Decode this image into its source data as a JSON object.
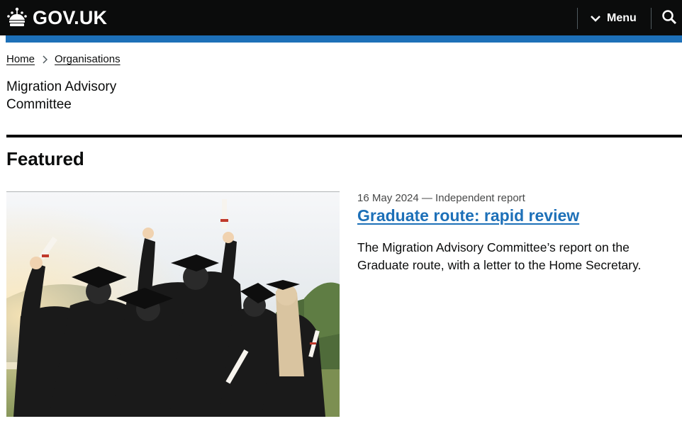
{
  "header": {
    "logo_text": "GOV.UK",
    "menu_label": "Menu",
    "colors": {
      "background": "#0b0c0c",
      "accent_bar": "#1d70b8"
    }
  },
  "breadcrumb": {
    "items": [
      {
        "label": "Home"
      },
      {
        "label": "Organisations"
      }
    ]
  },
  "organisation": {
    "name": "Migration Advisory Committee"
  },
  "featured": {
    "heading": "Featured",
    "story": {
      "meta": "16 May 2024 — Independent report",
      "title": "Graduate route: rapid review",
      "summary": "The Migration Advisory Committee’s report on the Graduate route, with a letter to the Home Secretary."
    }
  }
}
